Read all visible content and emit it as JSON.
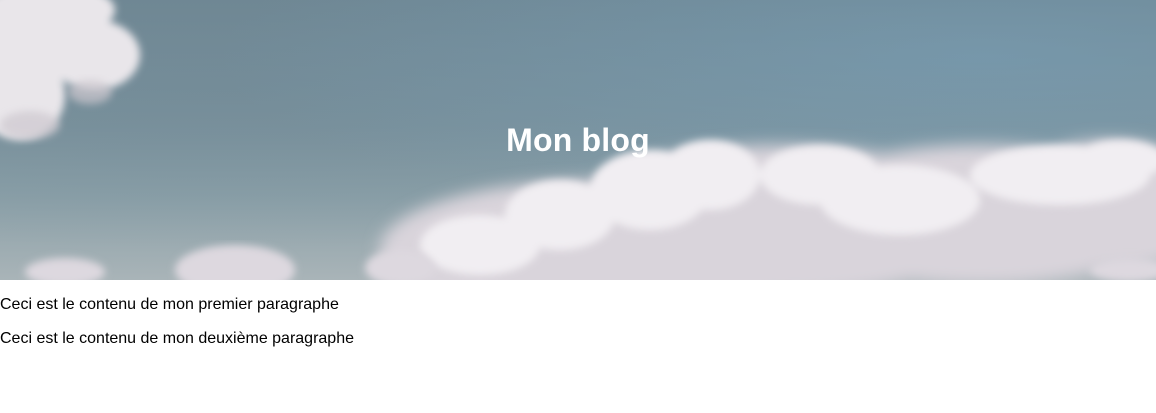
{
  "header": {
    "title": "Mon blog"
  },
  "main": {
    "paragraphs": [
      "Ceci est le contenu de mon premier paragraphe",
      "Ceci est le contenu de mon deuxième paragraphe"
    ]
  },
  "colors": {
    "title_text": "#ffffff",
    "body_text": "#000000",
    "sky": "#7c939d",
    "cloud": "#e6e3e8"
  }
}
